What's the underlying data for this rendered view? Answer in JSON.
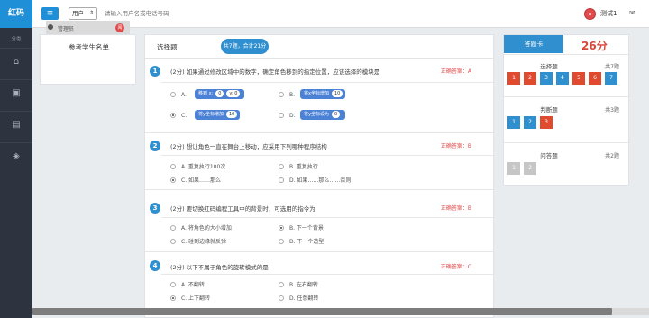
{
  "header": {
    "brand": "红码",
    "menu_icon": "≡",
    "user_select": "用户",
    "search_placeholder": "请输入用户名或电话号码",
    "username": "测试1",
    "mail_icon": "✉"
  },
  "sidebar": {
    "label": "分类",
    "items": [
      {
        "icon": "home-icon",
        "glyph": "⌂"
      },
      {
        "icon": "book-icon",
        "glyph": "▣"
      },
      {
        "icon": "book-open-icon",
        "glyph": "▤"
      },
      {
        "icon": "layers-icon",
        "glyph": "◈"
      }
    ]
  },
  "student_panel": {
    "title": "参考学生名单",
    "student_name": "管理员",
    "badge": "阅"
  },
  "main": {
    "title": "选择题",
    "pill": "共7题，合计21分"
  },
  "questions": [
    {
      "num": "1",
      "text": "(2分)  如果通过修改区域中的数字，确定角色移到的指定位置，应该选择的模块是",
      "answer": "正确答案：A",
      "options": [
        {
          "letter": "A.",
          "selected": false,
          "block": "移到 x:",
          "val": "0",
          "val2": "y: 0"
        },
        {
          "letter": "B.",
          "selected": false,
          "block": "将x坐标增加",
          "val": "10"
        },
        {
          "letter": "C.",
          "selected": true,
          "block": "将y坐标增加",
          "val": "10"
        },
        {
          "letter": "D.",
          "selected": false,
          "block": "将y坐标设为",
          "val": "0"
        }
      ]
    },
    {
      "num": "2",
      "text": "(2分)  想让角色一直在舞台上移动，应采用下列哪种程序结构",
      "answer": "正确答案：B",
      "options": [
        {
          "letter": "A. 重复执行100次",
          "selected": false
        },
        {
          "letter": "B. 重复执行",
          "selected": false
        },
        {
          "letter": "C. 如果……那么",
          "selected": true
        },
        {
          "letter": "D. 如果……那么……否则",
          "selected": false
        }
      ]
    },
    {
      "num": "3",
      "text": "(2分)  要切换红码编程工具中的背景时，可选用的指令为",
      "answer": "正确答案：B",
      "options": [
        {
          "letter": "A. 将角色的大小增加",
          "selected": false
        },
        {
          "letter": "B. 下一个背景",
          "selected": true
        },
        {
          "letter": "C. 碰到边缘就反弹",
          "selected": false
        },
        {
          "letter": "D. 下一个造型",
          "selected": false
        }
      ]
    },
    {
      "num": "4",
      "text": "(2分)  以下不属于角色的旋转模式的是",
      "answer": "正确答案：C",
      "options": [
        {
          "letter": "A. 不翻转",
          "selected": false
        },
        {
          "letter": "B. 左右翻转",
          "selected": false
        },
        {
          "letter": "C. 上下翻转",
          "selected": true
        },
        {
          "letter": "D. 任意翻转",
          "selected": false
        }
      ]
    }
  ],
  "answer_card": {
    "button": "答题卡",
    "score": "26分",
    "sections": [
      {
        "title": "选择题",
        "count": "共7题",
        "items": [
          {
            "n": "1",
            "color": "#e04a2f"
          },
          {
            "n": "2",
            "color": "#e04a2f"
          },
          {
            "n": "3",
            "color": "#2f8fcf"
          },
          {
            "n": "4",
            "color": "#2f8fcf"
          },
          {
            "n": "5",
            "color": "#e04a2f"
          },
          {
            "n": "6",
            "color": "#e04a2f"
          },
          {
            "n": "7",
            "color": "#2f8fcf"
          }
        ]
      },
      {
        "title": "判断题",
        "count": "共3题",
        "items": [
          {
            "n": "1",
            "color": "#2f8fcf"
          },
          {
            "n": "2",
            "color": "#2f8fcf"
          },
          {
            "n": "3",
            "color": "#e04a2f"
          }
        ]
      },
      {
        "title": "问答题",
        "count": "共2题",
        "items": [
          {
            "n": "1",
            "color": "#c6c6c6"
          },
          {
            "n": "2",
            "color": "#c6c6c6"
          }
        ]
      }
    ]
  }
}
